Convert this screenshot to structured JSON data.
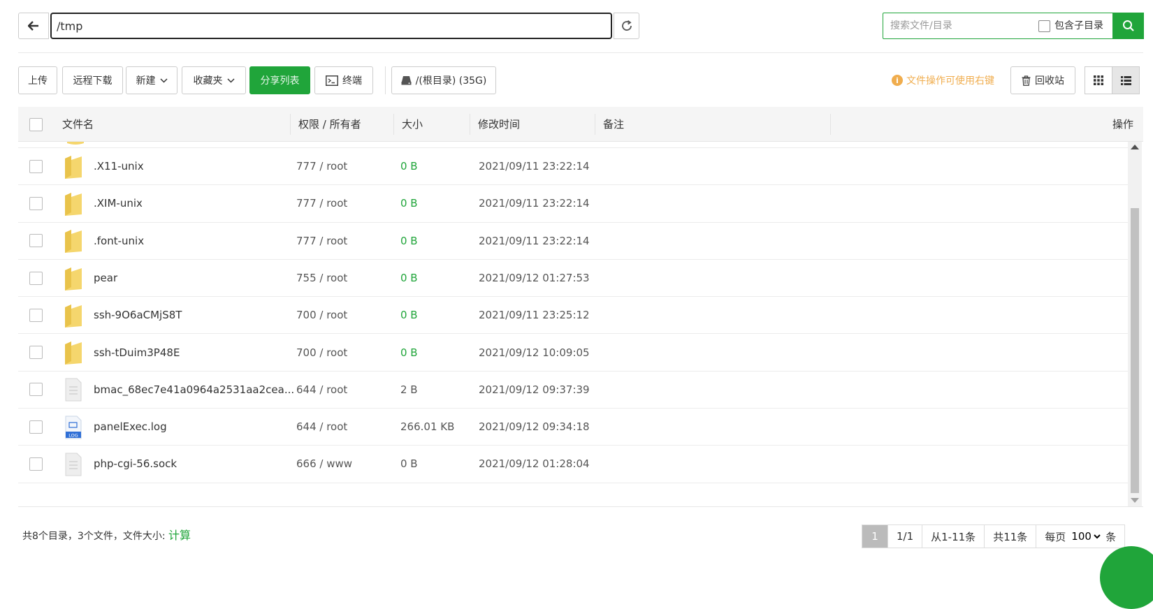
{
  "pathbar": {
    "path": "/tmp"
  },
  "search": {
    "placeholder": "搜索文件/目录",
    "subdir_label": "包含子目录"
  },
  "toolbar": {
    "upload": "上传",
    "remote_download": "远程下载",
    "new": "新建",
    "favorites": "收藏夹",
    "share_list": "分享列表",
    "terminal": "终端",
    "disk": "/(根目录) (35G)",
    "tip": "文件操作可使用右键",
    "recycle": "回收站"
  },
  "table": {
    "headers": {
      "name": "文件名",
      "perm": "权限 / 所有者",
      "size": "大小",
      "mtime": "修改时间",
      "note": "备注",
      "actions": "操作"
    },
    "rows": [
      {
        "icon": "folder",
        "name": ".X11-unix",
        "perm": "777 / root",
        "size": "0 B",
        "mtime": "2021/09/11 23:22:14"
      },
      {
        "icon": "folder",
        "name": ".XIM-unix",
        "perm": "777 / root",
        "size": "0 B",
        "mtime": "2021/09/11 23:22:14"
      },
      {
        "icon": "folder",
        "name": ".font-unix",
        "perm": "777 / root",
        "size": "0 B",
        "mtime": "2021/09/11 23:22:14"
      },
      {
        "icon": "folder",
        "name": "pear",
        "perm": "755 / root",
        "size": "0 B",
        "mtime": "2021/09/12 01:27:53"
      },
      {
        "icon": "folder",
        "name": "ssh-9O6aCMjS8T",
        "perm": "700 / root",
        "size": "0 B",
        "mtime": "2021/09/11 23:25:12"
      },
      {
        "icon": "folder",
        "name": "ssh-tDuim3P48E",
        "perm": "700 / root",
        "size": "0 B",
        "mtime": "2021/09/12 10:09:05"
      },
      {
        "icon": "file",
        "name": "bmac_68ec7e41a0964a2531aa2cea...",
        "perm": "644 / root",
        "size": "2 B",
        "mtime": "2021/09/12 09:37:39"
      },
      {
        "icon": "log",
        "name": "panelExec.log",
        "perm": "644 / root",
        "size": "266.01 KB",
        "mtime": "2021/09/12 09:34:18"
      },
      {
        "icon": "file",
        "name": "php-cgi-56.sock",
        "perm": "666 / www",
        "size": "0 B",
        "mtime": "2021/09/12 01:28:04"
      }
    ]
  },
  "footer": {
    "summary": "共8个目录，3个文件，文件大小: ",
    "calc": "计算",
    "page_current": "1",
    "page_total": "1/1",
    "range": "从1-11条",
    "total": "共11条",
    "per_page_label": "每页",
    "per_page_value": "100",
    "per_page_unit": "条"
  },
  "colors": {
    "accent": "#20a53a",
    "tip": "#f0ad4e",
    "folder": "#f5d66d"
  }
}
